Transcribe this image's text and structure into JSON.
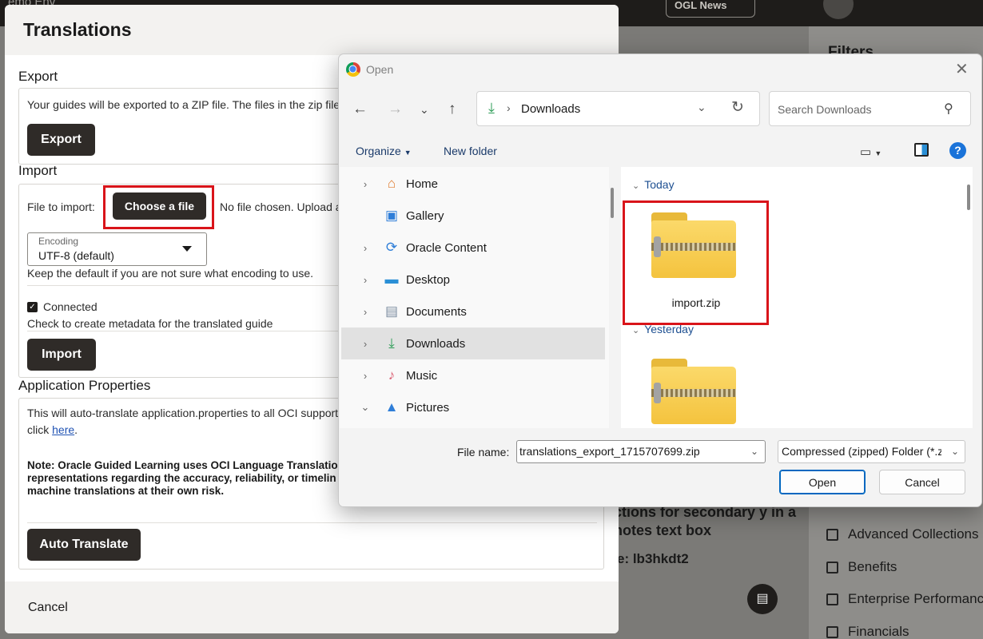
{
  "background": {
    "brand_partial": "emo Env",
    "news_label": "OGL News",
    "filters_title": "Filters",
    "filters": [
      "Advanced Collections",
      "Benefits",
      "Enterprise Performance",
      "Financials"
    ],
    "card_text": "ctions for secondary y in a notes text box",
    "card_code": "e: lb3hkdt2"
  },
  "modal": {
    "title": "Translations",
    "export": {
      "heading": "Export",
      "description": "Your guides will be exported to a ZIP file. The files in the zip file h",
      "button": "Export"
    },
    "import": {
      "heading": "Import",
      "file_label": "File to import:",
      "choose_button": "Choose a file",
      "no_file_text": "No file chosen. Upload a",
      "encoding_label": "Encoding",
      "encoding_value": "UTF-8 (default)",
      "encoding_hint": "Keep the default if you are not sure what encoding to use.",
      "connected_label": "Connected",
      "connected_checked": true,
      "connected_hint": "Check to create metadata for the translated guide",
      "button": "Import"
    },
    "app_props": {
      "heading": "Application Properties",
      "line1": "This will auto-translate application.properties to all OCI supporte",
      "click_prefix": "click ",
      "link": "here",
      "click_suffix": ".",
      "note": "Note: Oracle Guided Learning uses OCI Language Translation representations regarding the accuracy, reliability, or timelin machine translations at their own risk.",
      "button": "Auto Translate"
    },
    "cancel": "Cancel"
  },
  "dialog": {
    "title": "Open",
    "address_crumb": "Downloads",
    "search_placeholder": "Search Downloads",
    "toolbar": {
      "organize": "Organize",
      "new_folder": "New folder"
    },
    "nav": [
      {
        "label": "Home",
        "icon": "home-icon",
        "glyph": "⌂",
        "color": "#e07b2d",
        "chevron": "›",
        "selected": false
      },
      {
        "label": "Gallery",
        "icon": "gallery-icon",
        "glyph": "▣",
        "color": "#2f7ed8",
        "chevron": "",
        "selected": false
      },
      {
        "label": "Oracle Content",
        "icon": "sync-folder-icon",
        "glyph": "⟳",
        "color": "#2f7ed8",
        "chevron": "›",
        "selected": false
      },
      {
        "label": "Desktop",
        "icon": "desktop-icon",
        "glyph": "▬",
        "color": "#2a8fd6",
        "chevron": "›",
        "selected": false
      },
      {
        "label": "Documents",
        "icon": "documents-icon",
        "glyph": "▤",
        "color": "#7d8da1",
        "chevron": "›",
        "selected": false
      },
      {
        "label": "Downloads",
        "icon": "downloads-icon",
        "glyph": "⤓",
        "color": "#2c9c56",
        "chevron": "›",
        "selected": true
      },
      {
        "label": "Music",
        "icon": "music-icon",
        "glyph": "♪",
        "color": "#d95f73",
        "chevron": "›",
        "selected": false
      },
      {
        "label": "Pictures",
        "icon": "pictures-icon",
        "glyph": "▲",
        "color": "#2f7ed8",
        "chevron": "⌄",
        "selected": false
      }
    ],
    "groups": {
      "today": "Today",
      "yesterday": "Yesterday"
    },
    "files": {
      "today_file": "import.zip"
    },
    "file_name_label": "File name:",
    "file_name_value": "translations_export_1715707699.zip",
    "file_type_value": "Compressed (zipped) Folder (*.zip)",
    "open_button": "Open",
    "cancel_button": "Cancel"
  },
  "colors": {
    "highlight": "#d9141a",
    "dark_button": "#2f2b28",
    "link": "#1f52b3",
    "windows_accent": "#0067c0"
  }
}
